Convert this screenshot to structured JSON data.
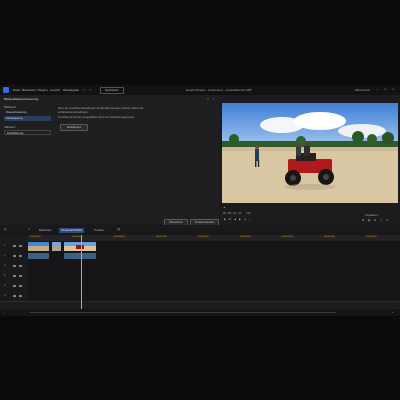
{
  "menubar": {
    "items": [
      "Datei",
      "Bearbeiten",
      "Plugins",
      "Ansicht",
      "Wiedergabe"
    ],
    "export_button": "Exportieren",
    "window_title": "Neues Projekt – Unbenannt – PowerDirector 365*",
    "right_text": "Mein Konto"
  },
  "panel": {
    "title": "Bildqualitätsverbesserung",
    "section1_label": "Bildbasiert",
    "section1_items": [
      "Videoverbesserung",
      "Farbanpassung"
    ],
    "section2_label": "Stilbasiert",
    "section2_items": [
      "Farbstilisierung"
    ],
    "desc_line1": "Wenn Sie zusätzliche Einstellungen auf das Bild anwenden möchten, klicken Sie",
    "desc_line2": "auf Erweiterte Einstellungen.",
    "desc_line3": "Der Effekt wird auf den ausgewählten Clip in der Zeitachse angewendet.",
    "advanced_button": "Einstellungen",
    "apply_button": "Übernehmen",
    "apply_all_button": "Auf alle anwenden"
  },
  "preview": {
    "timecode": "00 ; 00 ; 01 ; 22",
    "mode": "Clip",
    "fit_label": "Anpassen",
    "zoom": "Anpassen ▾"
  },
  "timeline": {
    "tabs": [
      "Bearbeiten",
      "Storyboard-Modus",
      "Timeline"
    ],
    "active_tab": 1,
    "ruler_ticks": [
      "00;00;00;00",
      "00;00;04;00",
      "00;00;08;00",
      "00;00;12;00",
      "00;00;16;00",
      "00;00;20;00",
      "00;00;24;00",
      "00;00;28;00",
      "00;00;32;00"
    ],
    "tracks": [
      "1.",
      "1.",
      "2.",
      "2.",
      "3.",
      "3."
    ]
  },
  "colors": {
    "accent": "#2c4b78",
    "playhead": "#f0a21b",
    "video_clip": "#3d6f8f",
    "audio_clip": "#3a6280"
  }
}
